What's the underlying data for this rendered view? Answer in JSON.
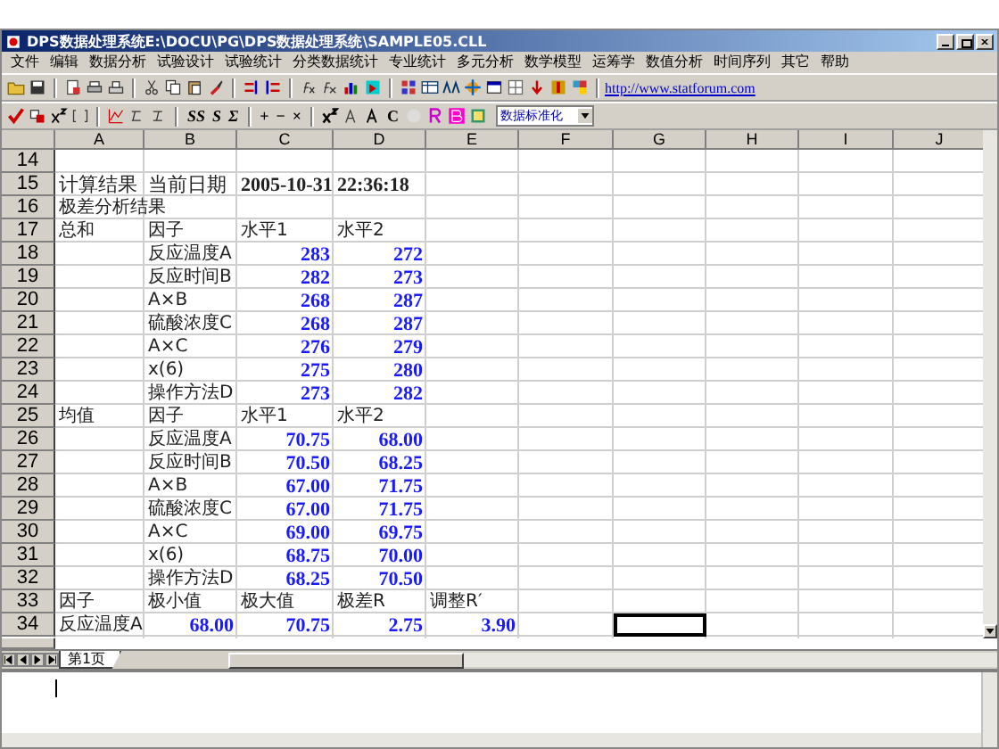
{
  "window": {
    "title": "DPS数据处理系统E:\\DOCU\\PG\\DPS数据处理系统\\SAMPLE05.CLL"
  },
  "menu": [
    "文件",
    "编辑",
    "数据分析",
    "试验设计",
    "试验统计",
    "分类数据统计",
    "专业统计",
    "多元分析",
    "数学模型",
    "运筹学",
    "数值分析",
    "时间序列",
    "其它",
    "帮助"
  ],
  "toolbar": {
    "link": "http://www.statforum.com",
    "glyph_buttons": [
      "SS",
      "S",
      "Σ",
      "+",
      "−",
      "×"
    ],
    "last_glyph": "C",
    "dropdown": "数据标准化"
  },
  "sheet": {
    "columns": [
      "A",
      "B",
      "C",
      "D",
      "E",
      "F",
      "G",
      "H",
      "I",
      "J"
    ],
    "rows": [
      {
        "label": "14",
        "cells": []
      },
      {
        "label": "15",
        "cells": [
          {
            "text": "计算结果",
            "kind": "heading"
          },
          {
            "text": "当前日期",
            "kind": "heading"
          },
          {
            "text": "2005-10-31",
            "kind": "bold"
          },
          {
            "text": "22:36:18",
            "kind": "bold"
          }
        ]
      },
      {
        "label": "16",
        "cells": [
          {
            "text": "极差分析结果",
            "kind": "text"
          }
        ]
      },
      {
        "label": "17",
        "cells": [
          {
            "text": "总和",
            "kind": "text"
          },
          {
            "text": "因子",
            "kind": "text"
          },
          {
            "text": "水平1",
            "kind": "text"
          },
          {
            "text": "水平2",
            "kind": "text"
          }
        ]
      },
      {
        "label": "18",
        "cells": [
          null,
          {
            "text": "反应温度A",
            "kind": "small"
          },
          {
            "text": "283",
            "kind": "number"
          },
          {
            "text": "272",
            "kind": "number"
          }
        ]
      },
      {
        "label": "19",
        "cells": [
          null,
          {
            "text": "反应时间B",
            "kind": "small"
          },
          {
            "text": "282",
            "kind": "number"
          },
          {
            "text": "273",
            "kind": "number"
          }
        ]
      },
      {
        "label": "20",
        "cells": [
          null,
          {
            "text": "A×B",
            "kind": "small"
          },
          {
            "text": "268",
            "kind": "number"
          },
          {
            "text": "287",
            "kind": "number"
          }
        ]
      },
      {
        "label": "21",
        "cells": [
          null,
          {
            "text": "硫酸浓度C",
            "kind": "small"
          },
          {
            "text": "268",
            "kind": "number"
          },
          {
            "text": "287",
            "kind": "number"
          }
        ]
      },
      {
        "label": "22",
        "cells": [
          null,
          {
            "text": "A×C",
            "kind": "small"
          },
          {
            "text": "276",
            "kind": "number"
          },
          {
            "text": "279",
            "kind": "number"
          }
        ]
      },
      {
        "label": "23",
        "cells": [
          null,
          {
            "text": "x(6)",
            "kind": "small"
          },
          {
            "text": "275",
            "kind": "number"
          },
          {
            "text": "280",
            "kind": "number"
          }
        ]
      },
      {
        "label": "24",
        "cells": [
          null,
          {
            "text": "操作方法D",
            "kind": "text"
          },
          {
            "text": "273",
            "kind": "number"
          },
          {
            "text": "282",
            "kind": "number"
          }
        ]
      },
      {
        "label": "25",
        "cells": [
          {
            "text": "均值",
            "kind": "text"
          },
          {
            "text": "因子",
            "kind": "text"
          },
          {
            "text": "水平1",
            "kind": "text"
          },
          {
            "text": "水平2",
            "kind": "text"
          }
        ]
      },
      {
        "label": "26",
        "cells": [
          null,
          {
            "text": "反应温度A",
            "kind": "small"
          },
          {
            "text": "70.75",
            "kind": "number"
          },
          {
            "text": "68.00",
            "kind": "number"
          }
        ]
      },
      {
        "label": "27",
        "cells": [
          null,
          {
            "text": "反应时间B",
            "kind": "small"
          },
          {
            "text": "70.50",
            "kind": "number"
          },
          {
            "text": "68.25",
            "kind": "number"
          }
        ]
      },
      {
        "label": "28",
        "cells": [
          null,
          {
            "text": "A×B",
            "kind": "small"
          },
          {
            "text": "67.00",
            "kind": "number"
          },
          {
            "text": "71.75",
            "kind": "number"
          }
        ]
      },
      {
        "label": "29",
        "cells": [
          null,
          {
            "text": "硫酸浓度C",
            "kind": "small"
          },
          {
            "text": "67.00",
            "kind": "number"
          },
          {
            "text": "71.75",
            "kind": "number"
          }
        ]
      },
      {
        "label": "30",
        "cells": [
          null,
          {
            "text": "A×C",
            "kind": "small"
          },
          {
            "text": "69.00",
            "kind": "number"
          },
          {
            "text": "69.75",
            "kind": "number"
          }
        ]
      },
      {
        "label": "31",
        "cells": [
          null,
          {
            "text": "x(6)",
            "kind": "small"
          },
          {
            "text": "68.75",
            "kind": "number"
          },
          {
            "text": "70.00",
            "kind": "number"
          }
        ]
      },
      {
        "label": "32",
        "cells": [
          null,
          {
            "text": "操作方法D",
            "kind": "text"
          },
          {
            "text": "68.25",
            "kind": "number"
          },
          {
            "text": "70.50",
            "kind": "number"
          }
        ]
      },
      {
        "label": "33",
        "cells": [
          {
            "text": "因子",
            "kind": "text"
          },
          {
            "text": "极小值",
            "kind": "text"
          },
          {
            "text": "极大值",
            "kind": "text"
          },
          {
            "text": "极差R",
            "kind": "small"
          },
          {
            "text": "调整R′",
            "kind": "small"
          }
        ]
      },
      {
        "label": "34",
        "cells": [
          {
            "text": "反应温度A",
            "kind": "small"
          },
          {
            "text": "68.00",
            "kind": "number"
          },
          {
            "text": "70.75",
            "kind": "number"
          },
          {
            "text": "2.75",
            "kind": "number"
          },
          {
            "text": "3.90",
            "kind": "number"
          },
          null,
          {
            "selected": true
          }
        ]
      }
    ],
    "tabs": [
      {
        "label": "第1页",
        "selected": true
      }
    ]
  }
}
